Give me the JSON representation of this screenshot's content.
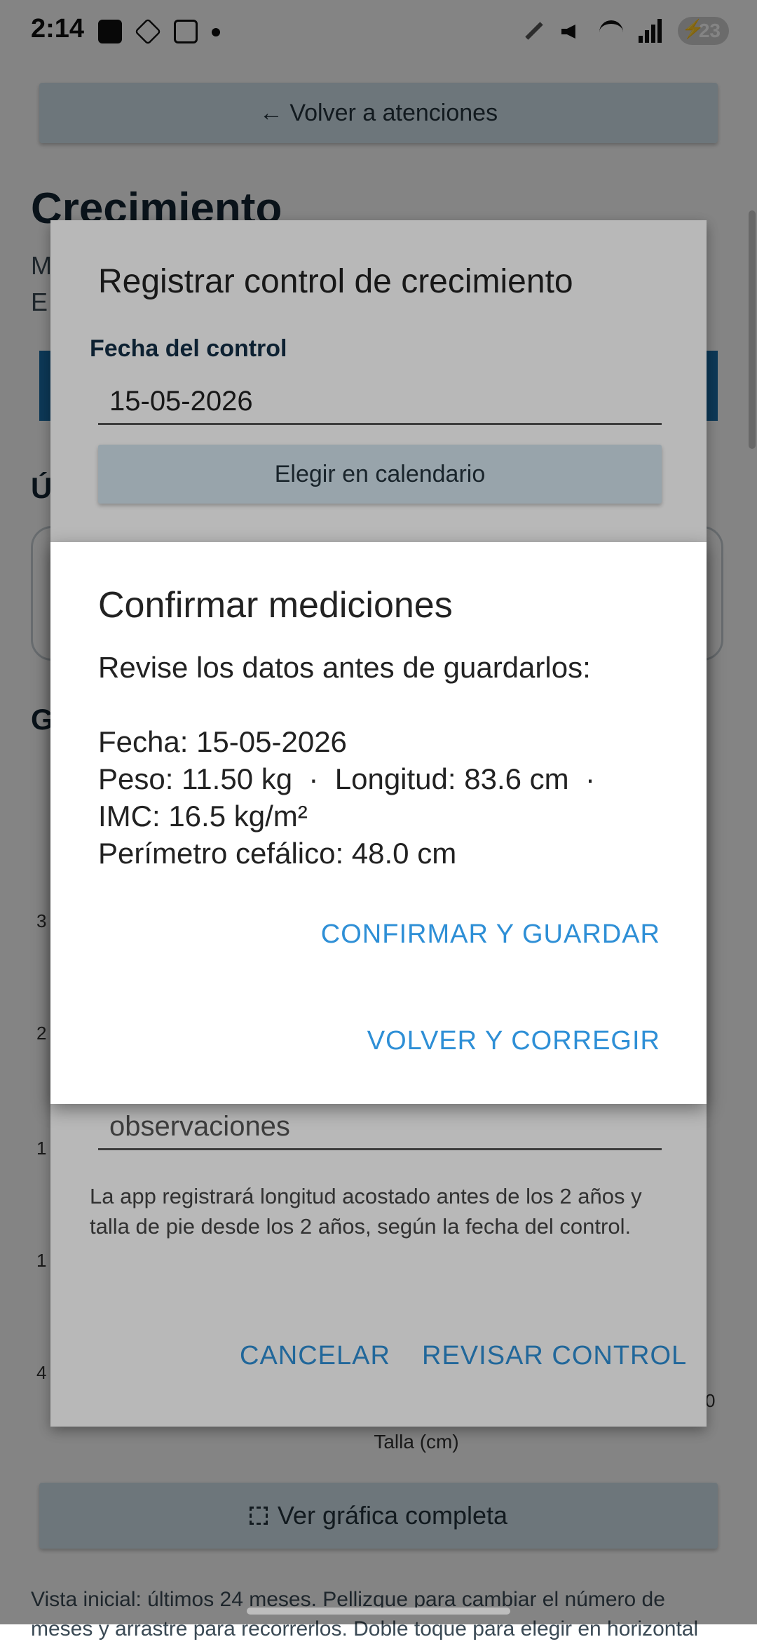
{
  "status_bar": {
    "time": "2:14",
    "battery": "23"
  },
  "page": {
    "back_button": "← Volver a atenciones",
    "title": "Crecimiento",
    "subtitle_1": "M",
    "subtitle_2": "E",
    "section_recent": "Ú",
    "section_chart": "G",
    "y_ticks": [
      "3",
      "2",
      "1",
      "1",
      "4"
    ],
    "x_tick_right": "0",
    "x_axis_label": "Talla (cm)",
    "full_chart_button": "Ver gráfica completa",
    "hint": "Vista inicial: últimos 24 meses. Pellizque para cambiar el número de meses y arrastre para recorrerlos. Doble toque para elegir en horizontal"
  },
  "register_dialog": {
    "title": "Registrar control de crecimiento",
    "date_label": "Fecha del control",
    "date_value": "15-05-2026",
    "calendar_button": "Elegir en calendario",
    "observations_placeholder": "observaciones",
    "note": "La app registrará longitud acostado antes de los 2 años y talla de pie desde los 2 años, según la fecha del control.",
    "cancel_button": "CANCELAR",
    "review_button": "REVISAR CONTROL"
  },
  "confirm_dialog": {
    "title": "Confirmar mediciones",
    "intro": "Revise los datos antes de guardarlos:",
    "line_date": "Fecha: 15-05-2026",
    "line_weight_length": "Peso: 11.50 kg  ·  Longitud: 83.6 cm  ·",
    "line_bmi": "IMC: 16.5 kg/m²",
    "line_head": "Perímetro cefálico: 48.0 cm",
    "confirm_button": "CONFIRMAR Y GUARDAR",
    "back_button": "VOLVER Y CORREGIR"
  },
  "colors": {
    "accent": "#2e8fd6",
    "primary_dark": "#1a6ea8",
    "tonal_button": "#d3e4ee"
  }
}
